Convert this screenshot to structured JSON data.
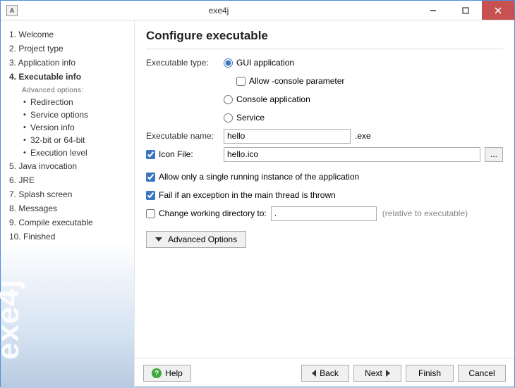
{
  "window": {
    "title": "exe4j"
  },
  "sidebar": {
    "watermark": "exe4j",
    "steps": [
      {
        "label": "1. Welcome"
      },
      {
        "label": "2. Project type"
      },
      {
        "label": "3. Application info"
      },
      {
        "label": "4. Executable info",
        "current": true,
        "subhead": "Advanced options:",
        "subs": [
          {
            "label": "Redirection"
          },
          {
            "label": "Service options"
          },
          {
            "label": "Version info"
          },
          {
            "label": "32-bit or 64-bit"
          },
          {
            "label": "Execution level"
          }
        ]
      },
      {
        "label": "5. Java invocation"
      },
      {
        "label": "6. JRE"
      },
      {
        "label": "7. Splash screen"
      },
      {
        "label": "8. Messages"
      },
      {
        "label": "9. Compile executable"
      },
      {
        "label": "10. Finished"
      }
    ]
  },
  "page": {
    "title": "Configure executable",
    "exec_type_label": "Executable type:",
    "radio_gui": "GUI application",
    "chk_console_param": "Allow -console parameter",
    "radio_console": "Console application",
    "radio_service": "Service",
    "exec_name_label": "Executable name:",
    "exec_name_value": "hello",
    "exec_ext": ".exe",
    "icon_file_label": "Icon File:",
    "icon_file_value": "hello.ico",
    "browse_label": "...",
    "chk_single_instance": "Allow only a single running instance of the application",
    "chk_fail_exception": "Fail if an exception in the main thread is thrown",
    "chk_change_dir": "Change working directory to:",
    "change_dir_value": ".",
    "change_dir_hint": "(relative to executable)",
    "advanced_btn": "Advanced Options"
  },
  "footer": {
    "help": "Help",
    "back": "Back",
    "next": "Next",
    "finish": "Finish",
    "cancel": "Cancel"
  }
}
